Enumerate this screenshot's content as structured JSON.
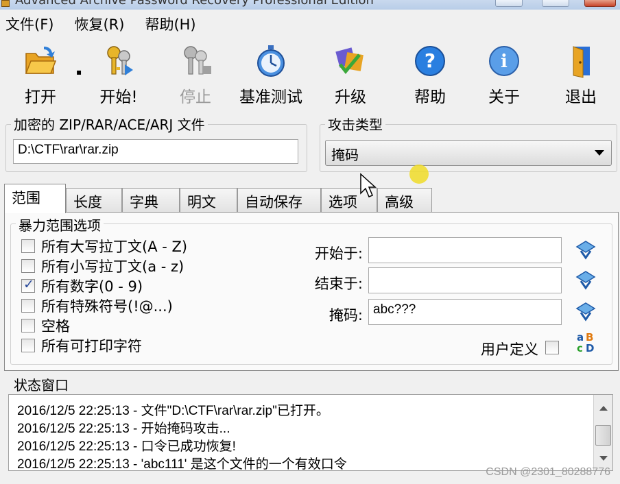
{
  "window": {
    "title": "Advanced Archive Password Recovery Professional Edition"
  },
  "menu": [
    "文件(F)",
    "恢复(R)",
    "帮助(H)"
  ],
  "toolbar": {
    "open": "打开",
    "start": "开始!",
    "stop": "停止",
    "benchmark": "基准测试",
    "upgrade": "升级",
    "help": "帮助",
    "about": "关于",
    "exit": "退出"
  },
  "file_group": {
    "title": "加密的 ZIP/RAR/ACE/ARJ 文件",
    "path": "D:\\CTF\\rar\\rar.zip"
  },
  "attack_group": {
    "title": "攻击类型",
    "selected": "掩码"
  },
  "tabs": [
    "范围",
    "长度",
    "字典",
    "明文",
    "自动保存",
    "选项",
    "高级"
  ],
  "range_panel": {
    "title": "暴力范围选项",
    "checks": [
      {
        "label": "所有大写拉丁文(A - Z)",
        "checked": false
      },
      {
        "label": "所有小写拉丁文(a - z)",
        "checked": false
      },
      {
        "label": "所有数字(0 - 9)",
        "checked": true
      },
      {
        "label": "所有特殊符号(!@...)",
        "checked": false
      },
      {
        "label": "空格",
        "checked": false
      },
      {
        "label": "所有可打印字符",
        "checked": false
      }
    ],
    "start_label": "开始于:",
    "start_value": "",
    "end_label": "结束于:",
    "end_value": "",
    "mask_label": "掩码:",
    "mask_value": "abc???",
    "user_defined_label": "用户定义"
  },
  "status": {
    "title": "状态窗口",
    "lines": [
      "2016/12/5 22:25:13 - 文件\"D:\\CTF\\rar\\rar.zip\"已打开。",
      "2016/12/5 22:25:13 - 开始掩码攻击...",
      "2016/12/5 22:25:13 - 口令已成功恢复!",
      "2016/12/5 22:25:13 - 'abc111' 是这个文件的一个有效口令"
    ]
  },
  "watermark": "CSDN @2301_80288776",
  "icons": {
    "open": "folder-open-icon",
    "start": "keys-icon",
    "stop": "keys-disabled-icon",
    "benchmark": "stopwatch-icon",
    "upgrade": "upgrade-icon",
    "help": "question-icon",
    "about": "info-icon",
    "exit": "door-icon"
  },
  "colors": {
    "accent_blue": "#2a6fd6",
    "check_color": "#2a4a9a"
  }
}
